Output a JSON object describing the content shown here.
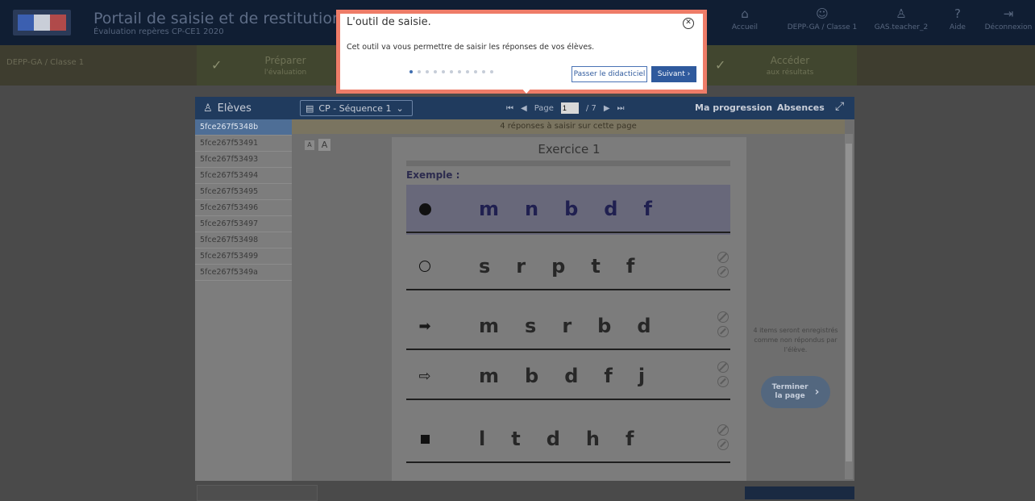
{
  "header": {
    "title": "Portail de saisie et de restitution",
    "subtitle": "Évaluation repères CP-CE1 2020",
    "nav": [
      {
        "label": "Accueil",
        "icon": "home-icon"
      },
      {
        "label": "DEPP-GA / Classe 1",
        "icon": "group-icon"
      },
      {
        "label": "GAS.teacher_2",
        "icon": "user-icon"
      },
      {
        "label": "Aide",
        "icon": "help-icon"
      },
      {
        "label": "Déconnexion",
        "icon": "logout-icon"
      }
    ]
  },
  "stepbar": {
    "class_label": "DEPP-GA / Classe 1",
    "prepare_line1": "Préparer",
    "prepare_line2": "l'évaluation",
    "access_line1": "Accéder",
    "access_line2": "aux résultats"
  },
  "toolbar": {
    "students_label": "Elèves",
    "sequence": "CP - Séquence 1",
    "page_label": "Page",
    "page_current": "1",
    "page_total": "/ 7",
    "progress": "Ma progression",
    "absences": "Absences"
  },
  "students": [
    "5fce267f5348b",
    "5fce267f53491",
    "5fce267f53493",
    "5fce267f53494",
    "5fce267f53495",
    "5fce267f53496",
    "5fce267f53497",
    "5fce267f53498",
    "5fce267f53499",
    "5fce267f5349a"
  ],
  "notice": "4 réponses à saisir sur cette page",
  "font_buttons": {
    "small": "A",
    "large": "A"
  },
  "exercise": {
    "title": "Exercice 1",
    "example_label": "Exemple :",
    "rows": [
      {
        "symbol": "dot",
        "letters": [
          "m",
          "n",
          "b",
          "d",
          "f"
        ],
        "example": true
      },
      {
        "symbol": "circle",
        "letters": [
          "s",
          "r",
          "p",
          "t",
          "f"
        ]
      },
      {
        "symbol": "arrow-right-filled",
        "letters": [
          "m",
          "s",
          "r",
          "b",
          "d"
        ]
      },
      {
        "symbol": "arrow-right-outline",
        "letters": [
          "m",
          "b",
          "d",
          "f",
          "j"
        ]
      },
      {
        "symbol": "square",
        "letters": [
          "l",
          "t",
          "d",
          "h",
          "f"
        ]
      }
    ]
  },
  "finish": {
    "note": "4 items seront enregistrés comme non répondus par l'élève.",
    "button_line1": "Terminer",
    "button_line2": "la page"
  },
  "popup": {
    "title": "L'outil de saisie.",
    "text": "Cet outil va vous permettre de saisir les réponses de vos élèves.",
    "skip": "Passer le didacticiel",
    "next": "Suivant",
    "step_count": 11,
    "step_active": 1,
    "accent": "#ee7c68",
    "primary": "#2f5a9d"
  }
}
